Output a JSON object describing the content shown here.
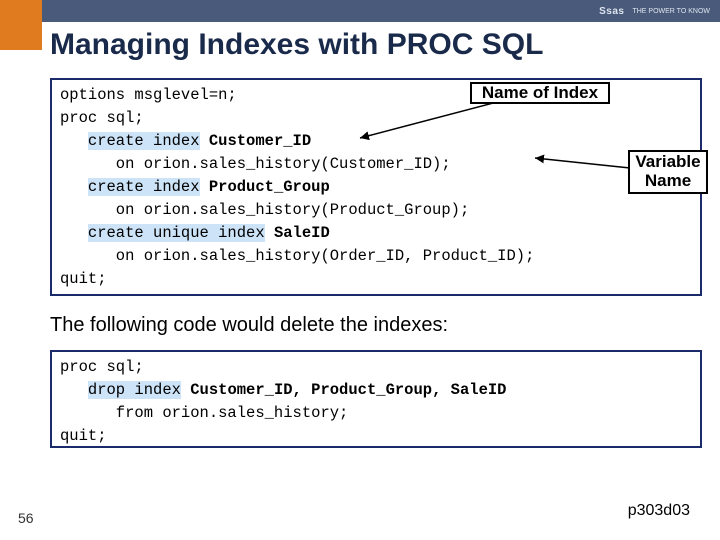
{
  "topbar": {
    "logo": "Ssas",
    "tag": "THE POWER TO KNOW"
  },
  "title": "Managing Indexes with PROC SQL",
  "callouts": {
    "name_of_index": "Name of Index",
    "variable_name": "Variable\nName"
  },
  "code1": {
    "l1a": "options msglevel=n;",
    "l2a": "proc sql;",
    "l3a": "   ",
    "l3b": "create index",
    "l3c": " ",
    "l3d": "Customer_ID",
    "l4a": "      on orion.sales_history(Customer_ID);",
    "l5a": "   ",
    "l5b": "create index",
    "l5c": " ",
    "l5d": "Product_Group",
    "l6a": "      on orion.sales_history(Product_Group);",
    "l7a": "   ",
    "l7b": "create unique index",
    "l7c": " ",
    "l7d": "SaleID",
    "l8a": "      on orion.sales_history(Order_ID, Product_ID);",
    "l9a": "quit;"
  },
  "midtext": "The following code would delete the indexes:",
  "code2": {
    "l1a": "proc sql;",
    "l2a": "   ",
    "l2b": "drop index",
    "l2c": " ",
    "l2d": "Customer_ID, Product_Group, SaleID",
    "l3a": "      from orion.sales_history;",
    "l4a": "quit;"
  },
  "slidenum": "56",
  "ref": "p303d03"
}
